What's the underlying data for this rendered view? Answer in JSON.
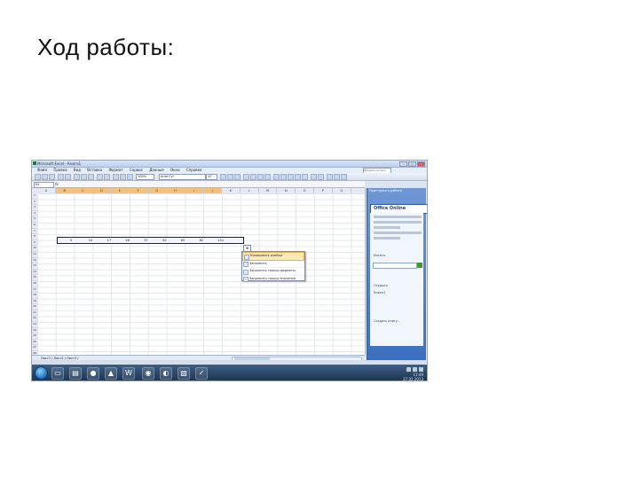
{
  "slide": {
    "title": "Ход работы:"
  },
  "app": {
    "title": "Microsoft Excel - Книга1",
    "help_placeholder": "Введите вопрос"
  },
  "menu": [
    "Файл",
    "Правка",
    "Вид",
    "Вставка",
    "Формат",
    "Сервис",
    "Данные",
    "Окно",
    "Справка"
  ],
  "toolbar": {
    "zoom": "100%",
    "font": "Arial Cyr",
    "size": "10"
  },
  "formula": {
    "namebox": "K4",
    "fx": "fx"
  },
  "columns": [
    "A",
    "B",
    "C",
    "D",
    "E",
    "F",
    "G",
    "H",
    "I",
    "J",
    "K",
    "L",
    "M",
    "N",
    "O",
    "P",
    "Q"
  ],
  "selected_columns": [
    "B",
    "C",
    "D",
    "E",
    "F",
    "G",
    "H",
    "I",
    "J"
  ],
  "rows": [
    "1",
    "2",
    "3",
    "4",
    "5",
    "6",
    "7",
    "8",
    "9",
    "10",
    "11",
    "12",
    "13",
    "14",
    "15",
    "16",
    "17",
    "18",
    "19",
    "20",
    "21",
    "22",
    "23",
    "24",
    "25",
    "26",
    "27",
    "28",
    "29",
    "30",
    "31",
    "32"
  ],
  "data_row": {
    "label": "4",
    "values": [
      "5",
      "10",
      "17",
      "26",
      "37",
      "50",
      "65",
      "82",
      "101"
    ]
  },
  "context_menu": [
    {
      "label": "Копировать ячейки",
      "icon": "copy-icon"
    },
    {
      "label": "Заполнить",
      "icon": "fill-icon"
    },
    {
      "label": "Заполнить только форматы",
      "icon": "format-icon"
    },
    {
      "label": "Заполнить только значения",
      "icon": "values-icon"
    }
  ],
  "sheets": {
    "label": "Лист1 / Лист2 / Лист3 /"
  },
  "taskpane": {
    "header": "Приступая к работе",
    "logo": "Office Online",
    "search_label": "Искать:",
    "links": [
      "Открыть",
      "Книга1",
      "Создать книгу..."
    ]
  },
  "taskbar": {
    "time": "11:49",
    "date": "27.02.2013"
  },
  "colors": {
    "selection": "#f3c27a",
    "taskpane": "#3d6fc0",
    "taskbar": "#1e3550"
  }
}
